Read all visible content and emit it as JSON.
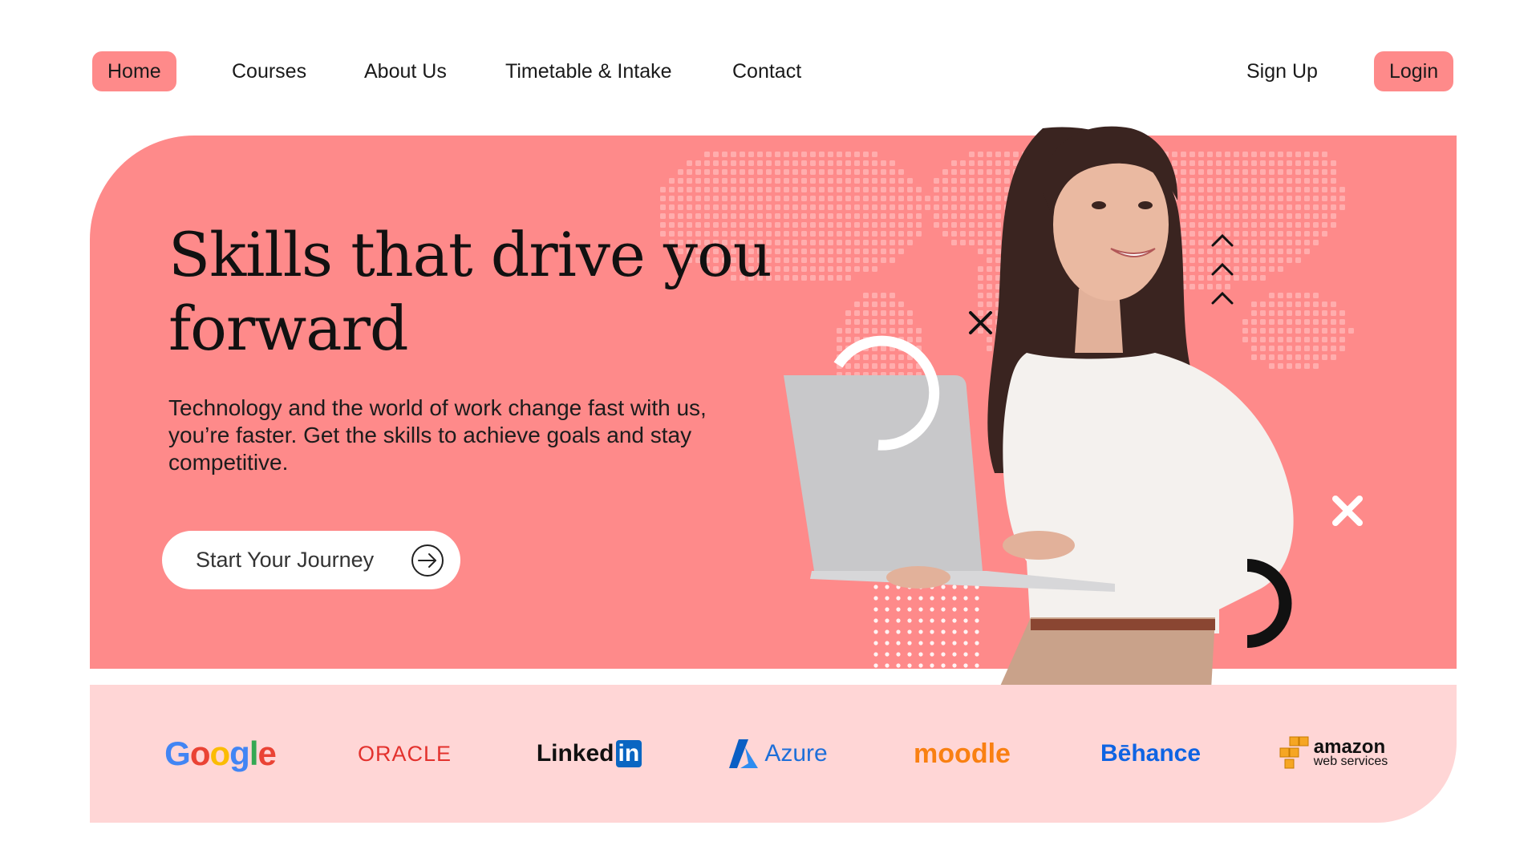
{
  "nav": {
    "home": "Home",
    "courses": "Courses",
    "about": "About Us",
    "timetable": "Timetable & Intake",
    "contact": "Contact",
    "signup": "Sign Up",
    "login": "Login"
  },
  "hero": {
    "headline_line1": "Skills that drive you",
    "headline_line2": "forward",
    "subtext": "Technology and the world of work change fast with us, you’re faster. Get the skills to achieve goals and stay competitive.",
    "cta_label": "Start Your Journey",
    "cta_icon": "arrow-right-circle-icon"
  },
  "logos": {
    "google": "Google",
    "oracle": "ORACLE",
    "linkedin_text": "Linked",
    "linkedin_box": "in",
    "azure": "Azure",
    "moodle": "moodle",
    "behance": "Bēhance",
    "aws_main": "amazon",
    "aws_sub": "web services"
  },
  "colors": {
    "accent": "#fe8a8a",
    "strip": "#ffd6d6",
    "text": "#111111"
  }
}
